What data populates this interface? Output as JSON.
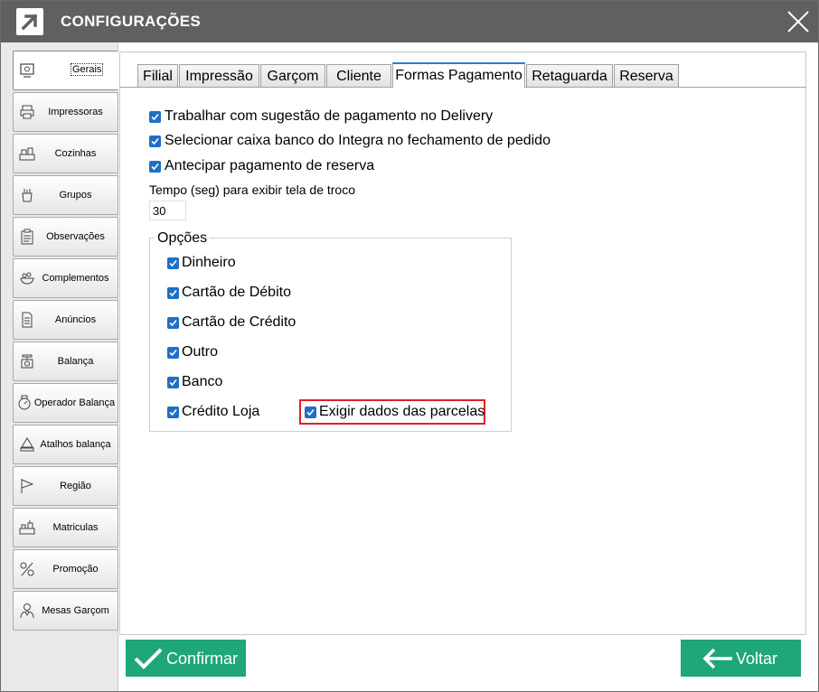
{
  "window": {
    "title": "CONFIGURAÇÕES"
  },
  "sidebar": {
    "items": [
      {
        "label": "Gerais",
        "icon": "settings-screen-icon",
        "active": true
      },
      {
        "label": "Impressoras",
        "icon": "printer-icon"
      },
      {
        "label": "Cozinhas",
        "icon": "kitchen-icon"
      },
      {
        "label": "Grupos",
        "icon": "groups-icon"
      },
      {
        "label": "Observações",
        "icon": "clipboard-icon"
      },
      {
        "label": "Complementos",
        "icon": "complements-icon"
      },
      {
        "label": "Anúncios",
        "icon": "document-icon"
      },
      {
        "label": "Balança",
        "icon": "scale-icon"
      },
      {
        "label": "Operador Balança",
        "icon": "scale-operator-icon"
      },
      {
        "label": "Atalhos balança",
        "icon": "scale-shortcut-icon"
      },
      {
        "label": "Região",
        "icon": "flag-icon"
      },
      {
        "label": "Matriculas",
        "icon": "registrations-icon"
      },
      {
        "label": "Promoção",
        "icon": "promotion-icon"
      },
      {
        "label": "Mesas Garçom",
        "icon": "waiter-icon"
      }
    ]
  },
  "tabs": [
    {
      "label": "Filial"
    },
    {
      "label": "Impressão"
    },
    {
      "label": "Garçom"
    },
    {
      "label": "Cliente"
    },
    {
      "label": "Formas Pagamento",
      "active": true
    },
    {
      "label": "Retaguarda"
    },
    {
      "label": "Reserva"
    }
  ],
  "payment": {
    "opt_delivery": {
      "label": "Trabalhar com sugestão de pagamento no Delivery",
      "checked": true
    },
    "opt_caixa": {
      "label": "Selecionar caixa banco do Integra no fechamento de pedido",
      "checked": true
    },
    "opt_reserva": {
      "label": "Antecipar pagamento de reserva",
      "checked": true
    },
    "tempo_label": "Tempo (seg) para exibir tela de troco",
    "tempo_value": "30",
    "options_title": "Opções",
    "options": [
      {
        "label": "Dinheiro",
        "checked": true
      },
      {
        "label": "Cartão de Débito",
        "checked": true
      },
      {
        "label": "Cartão de Crédito",
        "checked": true
      },
      {
        "label": "Outro",
        "checked": true
      },
      {
        "label": "Banco",
        "checked": true
      },
      {
        "label": "Crédito Loja",
        "checked": true
      }
    ],
    "parcelas": {
      "label": "Exigir dados das parcelas",
      "checked": true
    }
  },
  "footer": {
    "confirm_label": "Confirmar",
    "back_label": "Voltar"
  },
  "colors": {
    "titlebar": "#606060",
    "accent": "#1f6fc5",
    "button": "#1fa67a",
    "highlight": "#e0202a"
  }
}
